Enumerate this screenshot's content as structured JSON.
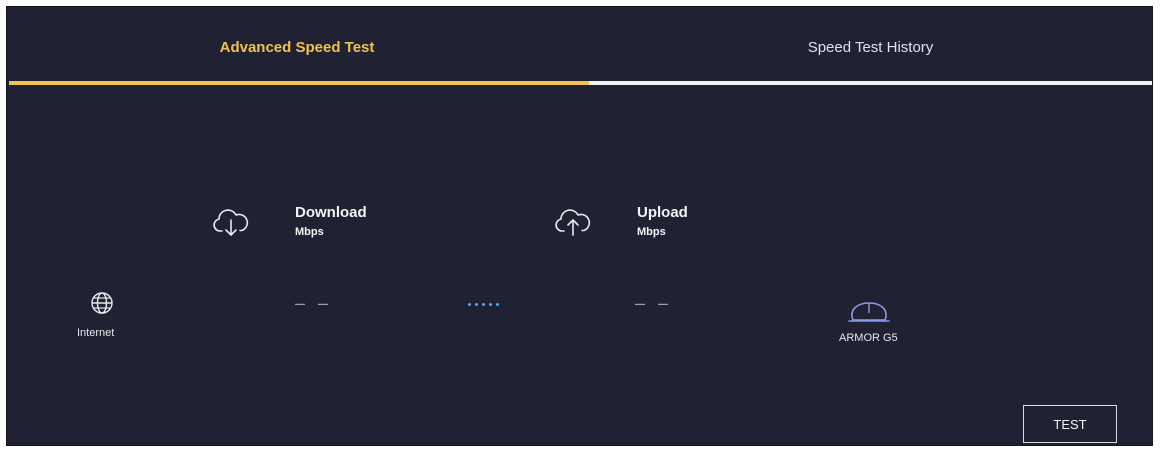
{
  "tabs": {
    "advanced": "Advanced Speed Test",
    "history": "Speed Test History"
  },
  "download": {
    "title": "Download",
    "unit": "Mbps",
    "value": "– –"
  },
  "upload": {
    "title": "Upload",
    "unit": "Mbps",
    "value": "– –"
  },
  "nodes": {
    "internet": "Internet",
    "device": "ARMOR G5"
  },
  "actions": {
    "test": "TEST"
  },
  "colors": {
    "background": "#202233",
    "accent": "#f2c14e",
    "dots": "#4aa8e8"
  },
  "icons": {
    "download": "cloud-download-icon",
    "upload": "cloud-upload-icon",
    "internet": "globe-icon",
    "device": "router-icon"
  }
}
